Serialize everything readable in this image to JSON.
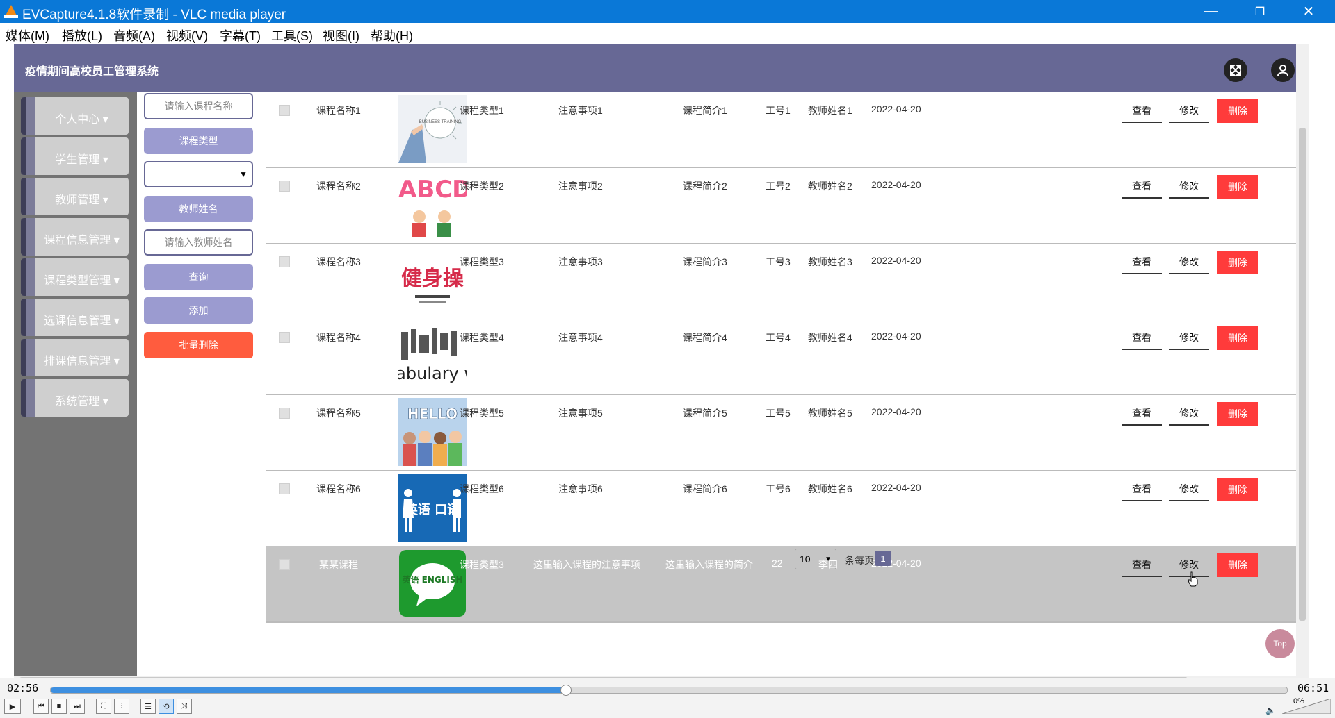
{
  "window": {
    "title": "EVCapture4.1.8软件录制 - VLC media player",
    "minimize": "—",
    "restore": "❐",
    "close": "✕"
  },
  "menu": [
    "媒体(M)",
    "播放(L)",
    "音频(A)",
    "视频(V)",
    "字幕(T)",
    "工具(S)",
    "视图(I)",
    "帮助(H)"
  ],
  "app": {
    "title": "疫情期间高校员工管理系统",
    "fullscreen_icon": "expand-icon",
    "user_icon": "user-icon"
  },
  "sidebar": {
    "items": [
      "个人中心",
      "学生管理",
      "教师管理",
      "课程信息管理",
      "课程类型管理",
      "选课信息管理",
      "排课信息管理",
      "系统管理"
    ]
  },
  "filters": {
    "course_name_placeholder": "请输入课程名称",
    "course_type_label": "课程类型",
    "course_type_value": "",
    "teacher_name_label": "教师姓名",
    "teacher_name_placeholder": "请输入教师姓名",
    "query_button": "查询",
    "add_button": "添加",
    "batch_delete_button": "批量删除"
  },
  "actions": {
    "view": "查看",
    "edit": "修改",
    "delete": "删除"
  },
  "rows": [
    {
      "name": "课程名称1",
      "type": "课程类型1",
      "notes": "注意事项1",
      "intro": "课程简介1",
      "staff_no": "工号1",
      "teacher": "教师姓名1",
      "date": "2022-04-20",
      "image_caption": "BUSINESS TRAINING"
    },
    {
      "name": "课程名称2",
      "type": "课程类型2",
      "notes": "注意事项2",
      "intro": "课程简介2",
      "staff_no": "工号2",
      "teacher": "教师姓名2",
      "date": "2022-04-20",
      "image_caption": "ABCD"
    },
    {
      "name": "课程名称3",
      "type": "课程类型3",
      "notes": "注意事项3",
      "intro": "课程简介3",
      "staff_no": "工号3",
      "teacher": "教师姓名3",
      "date": "2022-04-20",
      "image_caption": "健身操"
    },
    {
      "name": "课程名称4",
      "type": "课程类型4",
      "notes": "注意事项4",
      "intro": "课程简介4",
      "staff_no": "工号4",
      "teacher": "教师姓名4",
      "date": "2022-04-20",
      "image_caption": "vocabulary words"
    },
    {
      "name": "课程名称5",
      "type": "课程类型5",
      "notes": "注意事项5",
      "intro": "课程简介5",
      "staff_no": "工号5",
      "teacher": "教师姓名5",
      "date": "2022-04-20",
      "image_caption": "HELLO"
    },
    {
      "name": "课程名称6",
      "type": "课程类型6",
      "notes": "注意事项6",
      "intro": "课程简介6",
      "staff_no": "工号6",
      "teacher": "教师姓名6",
      "date": "2022-04-20",
      "image_caption": "英语 口语"
    },
    {
      "name": "某某课程",
      "type": "课程类型3",
      "notes": "这里输入课程的注意事项",
      "intro": "这里输入课程的简介",
      "staff_no": "22",
      "teacher": "李四",
      "date": "2022-04-20",
      "image_caption": "英语 ENGLISH"
    }
  ],
  "pagination": {
    "page_size": "10",
    "per_page_label": "条每页",
    "current_page": "1"
  },
  "top_button": "Top",
  "player": {
    "elapsed": "02:56",
    "total": "06:51",
    "progress_fraction": 0.416,
    "volume": "0%"
  }
}
